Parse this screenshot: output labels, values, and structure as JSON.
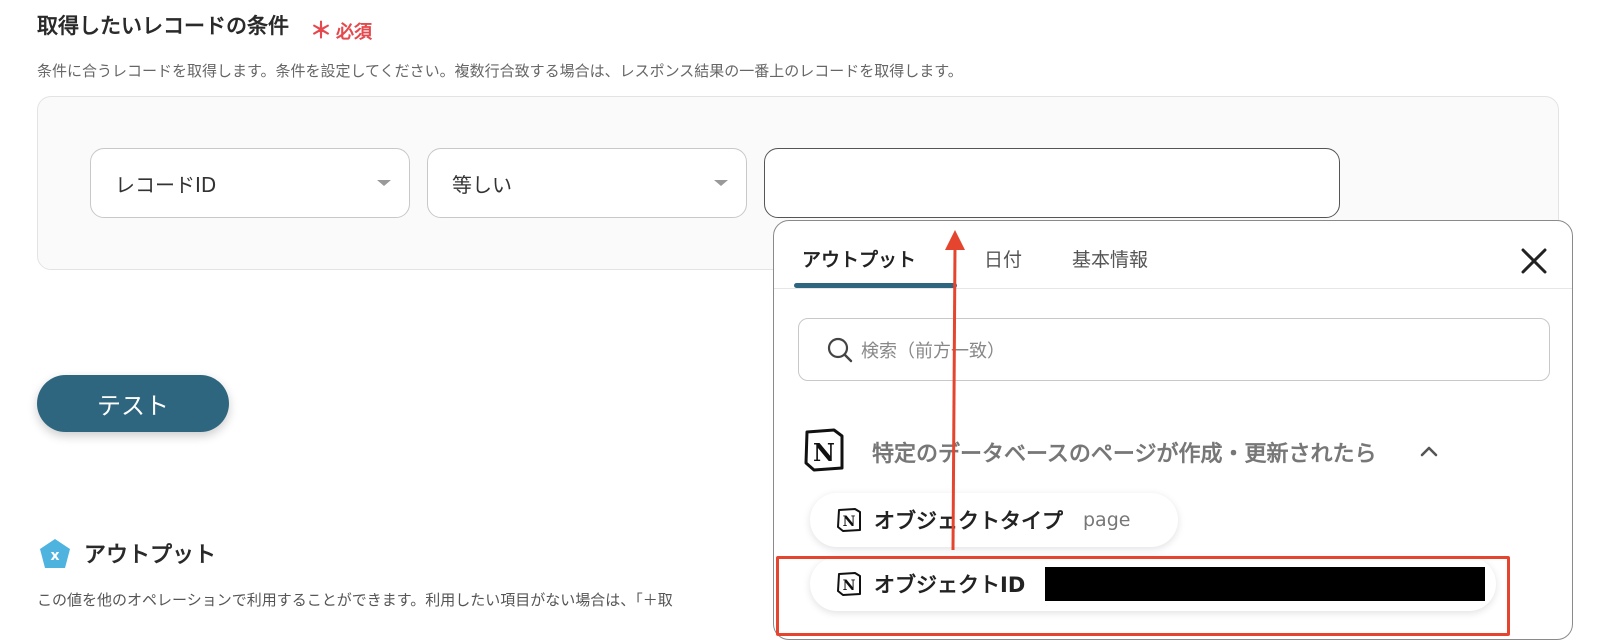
{
  "section": {
    "title": "取得したいレコードの条件",
    "required_mark": "＊",
    "required_label": "必須",
    "description": "条件に合うレコードを取得します。条件を設定してください。複数行合致する場合は、レスポンス結果の一番上のレコードを取得します。"
  },
  "condition": {
    "field_select": "レコードID",
    "operator_select": "等しい",
    "value_input": ""
  },
  "test_button": "テスト",
  "output": {
    "title": "アウトプット",
    "description": "この値を他のオペレーションで利用することができます。利用したい項目がない場合は、「＋取"
  },
  "popover": {
    "tabs": [
      {
        "label": "アウトプット",
        "active": true
      },
      {
        "label": "日付",
        "active": false
      },
      {
        "label": "基本情報",
        "active": false
      }
    ],
    "search_placeholder": "検索（前方一致）",
    "group": {
      "label": "特定のデータベースのページが作成・更新されたら",
      "items": [
        {
          "name": "オブジェクトタイプ",
          "value": "page"
        },
        {
          "name": "オブジェクトID",
          "value": ""
        }
      ]
    }
  },
  "colors": {
    "accent": "#2e6680",
    "required": "#e5484d",
    "annotation": "#e5452e"
  },
  "icons": {
    "output_icon": "pentagon-x-icon",
    "close": "close-icon",
    "search": "search-icon",
    "notion": "notion-logo-icon",
    "chevron": "chevron-up-icon"
  }
}
